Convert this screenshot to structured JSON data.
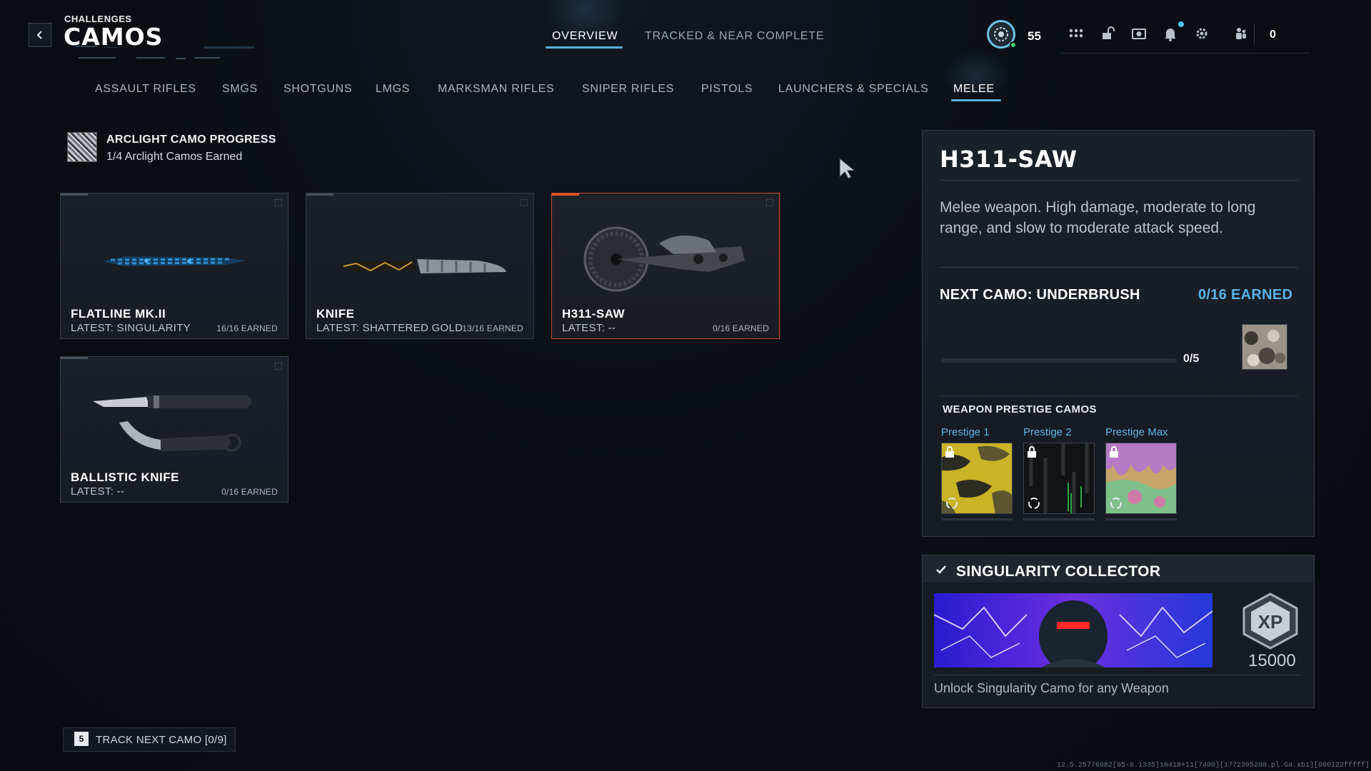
{
  "header": {
    "supertitle": "CHALLENGES",
    "title": "CAMOS",
    "tabs": [
      {
        "label": "OVERVIEW",
        "active": true
      },
      {
        "label": "TRACKED & NEAR COMPLETE",
        "active": false
      }
    ]
  },
  "hud": {
    "level": "55",
    "friends_count": "0",
    "icons": [
      "apps-grid-icon",
      "unlock-icon",
      "store-icon",
      "notification-bell-icon",
      "settings-gear-icon",
      "social-icon"
    ]
  },
  "categories": [
    {
      "label": "ASSAULT RIFLES",
      "active": false
    },
    {
      "label": "SMGS",
      "active": false
    },
    {
      "label": "SHOTGUNS",
      "active": false
    },
    {
      "label": "LMGS",
      "active": false
    },
    {
      "label": "MARKSMAN RIFLES",
      "active": false
    },
    {
      "label": "SNIPER RIFLES",
      "active": false
    },
    {
      "label": "PISTOLS",
      "active": false
    },
    {
      "label": "LAUNCHERS & SPECIALS",
      "active": false
    },
    {
      "label": "MELEE",
      "active": true
    }
  ],
  "arclight": {
    "title": "ARCLIGHT CAMO PROGRESS",
    "subtitle": "1/4 Arclight Camos Earned"
  },
  "weapons": [
    {
      "name": "FLATLINE MK.II",
      "latest": "LATEST: SINGULARITY",
      "earned": "16/16 EARNED",
      "selected": false
    },
    {
      "name": "KNIFE",
      "latest": "LATEST: SHATTERED GOLD",
      "earned": "13/16 EARNED",
      "selected": false
    },
    {
      "name": "H311-SAW",
      "latest": "LATEST: --",
      "earned": "0/16 EARNED",
      "selected": true
    },
    {
      "name": "BALLISTIC KNIFE",
      "latest": "LATEST: --",
      "earned": "0/16 EARNED",
      "selected": false
    }
  ],
  "detail": {
    "title": "H311-SAW",
    "description": "Melee weapon. High damage, moderate to long range, and slow to moderate attack speed.",
    "next_camo_label": "NEXT CAMO: UNDERBRUSH",
    "next_camo_earned": "0/16 EARNED",
    "progress_text": "0/5",
    "progress_fraction": 0,
    "prestige_heading": "WEAPON PRESTIGE CAMOS",
    "prestige": [
      {
        "label": "Prestige 1",
        "locked": true
      },
      {
        "label": "Prestige 2",
        "locked": true
      },
      {
        "label": "Prestige Max",
        "locked": true
      }
    ]
  },
  "collector": {
    "title": "SINGULARITY COLLECTOR",
    "xp_label": "XP",
    "xp_amount": "15000",
    "description": "Unlock Singularity Camo for any Weapon"
  },
  "footer": {
    "track_key": "5",
    "track_label": "TRACK NEXT CAMO [0/9]",
    "build_info": "12.5.25776082[95-0.1335]10418+11[7400][1772305208.pl.Ga.xb1][000122fffff]"
  },
  "colors": {
    "accent_blue": "#5ab3e6",
    "selected_border": "#c74a2e",
    "online_green": "#3fd46a"
  }
}
